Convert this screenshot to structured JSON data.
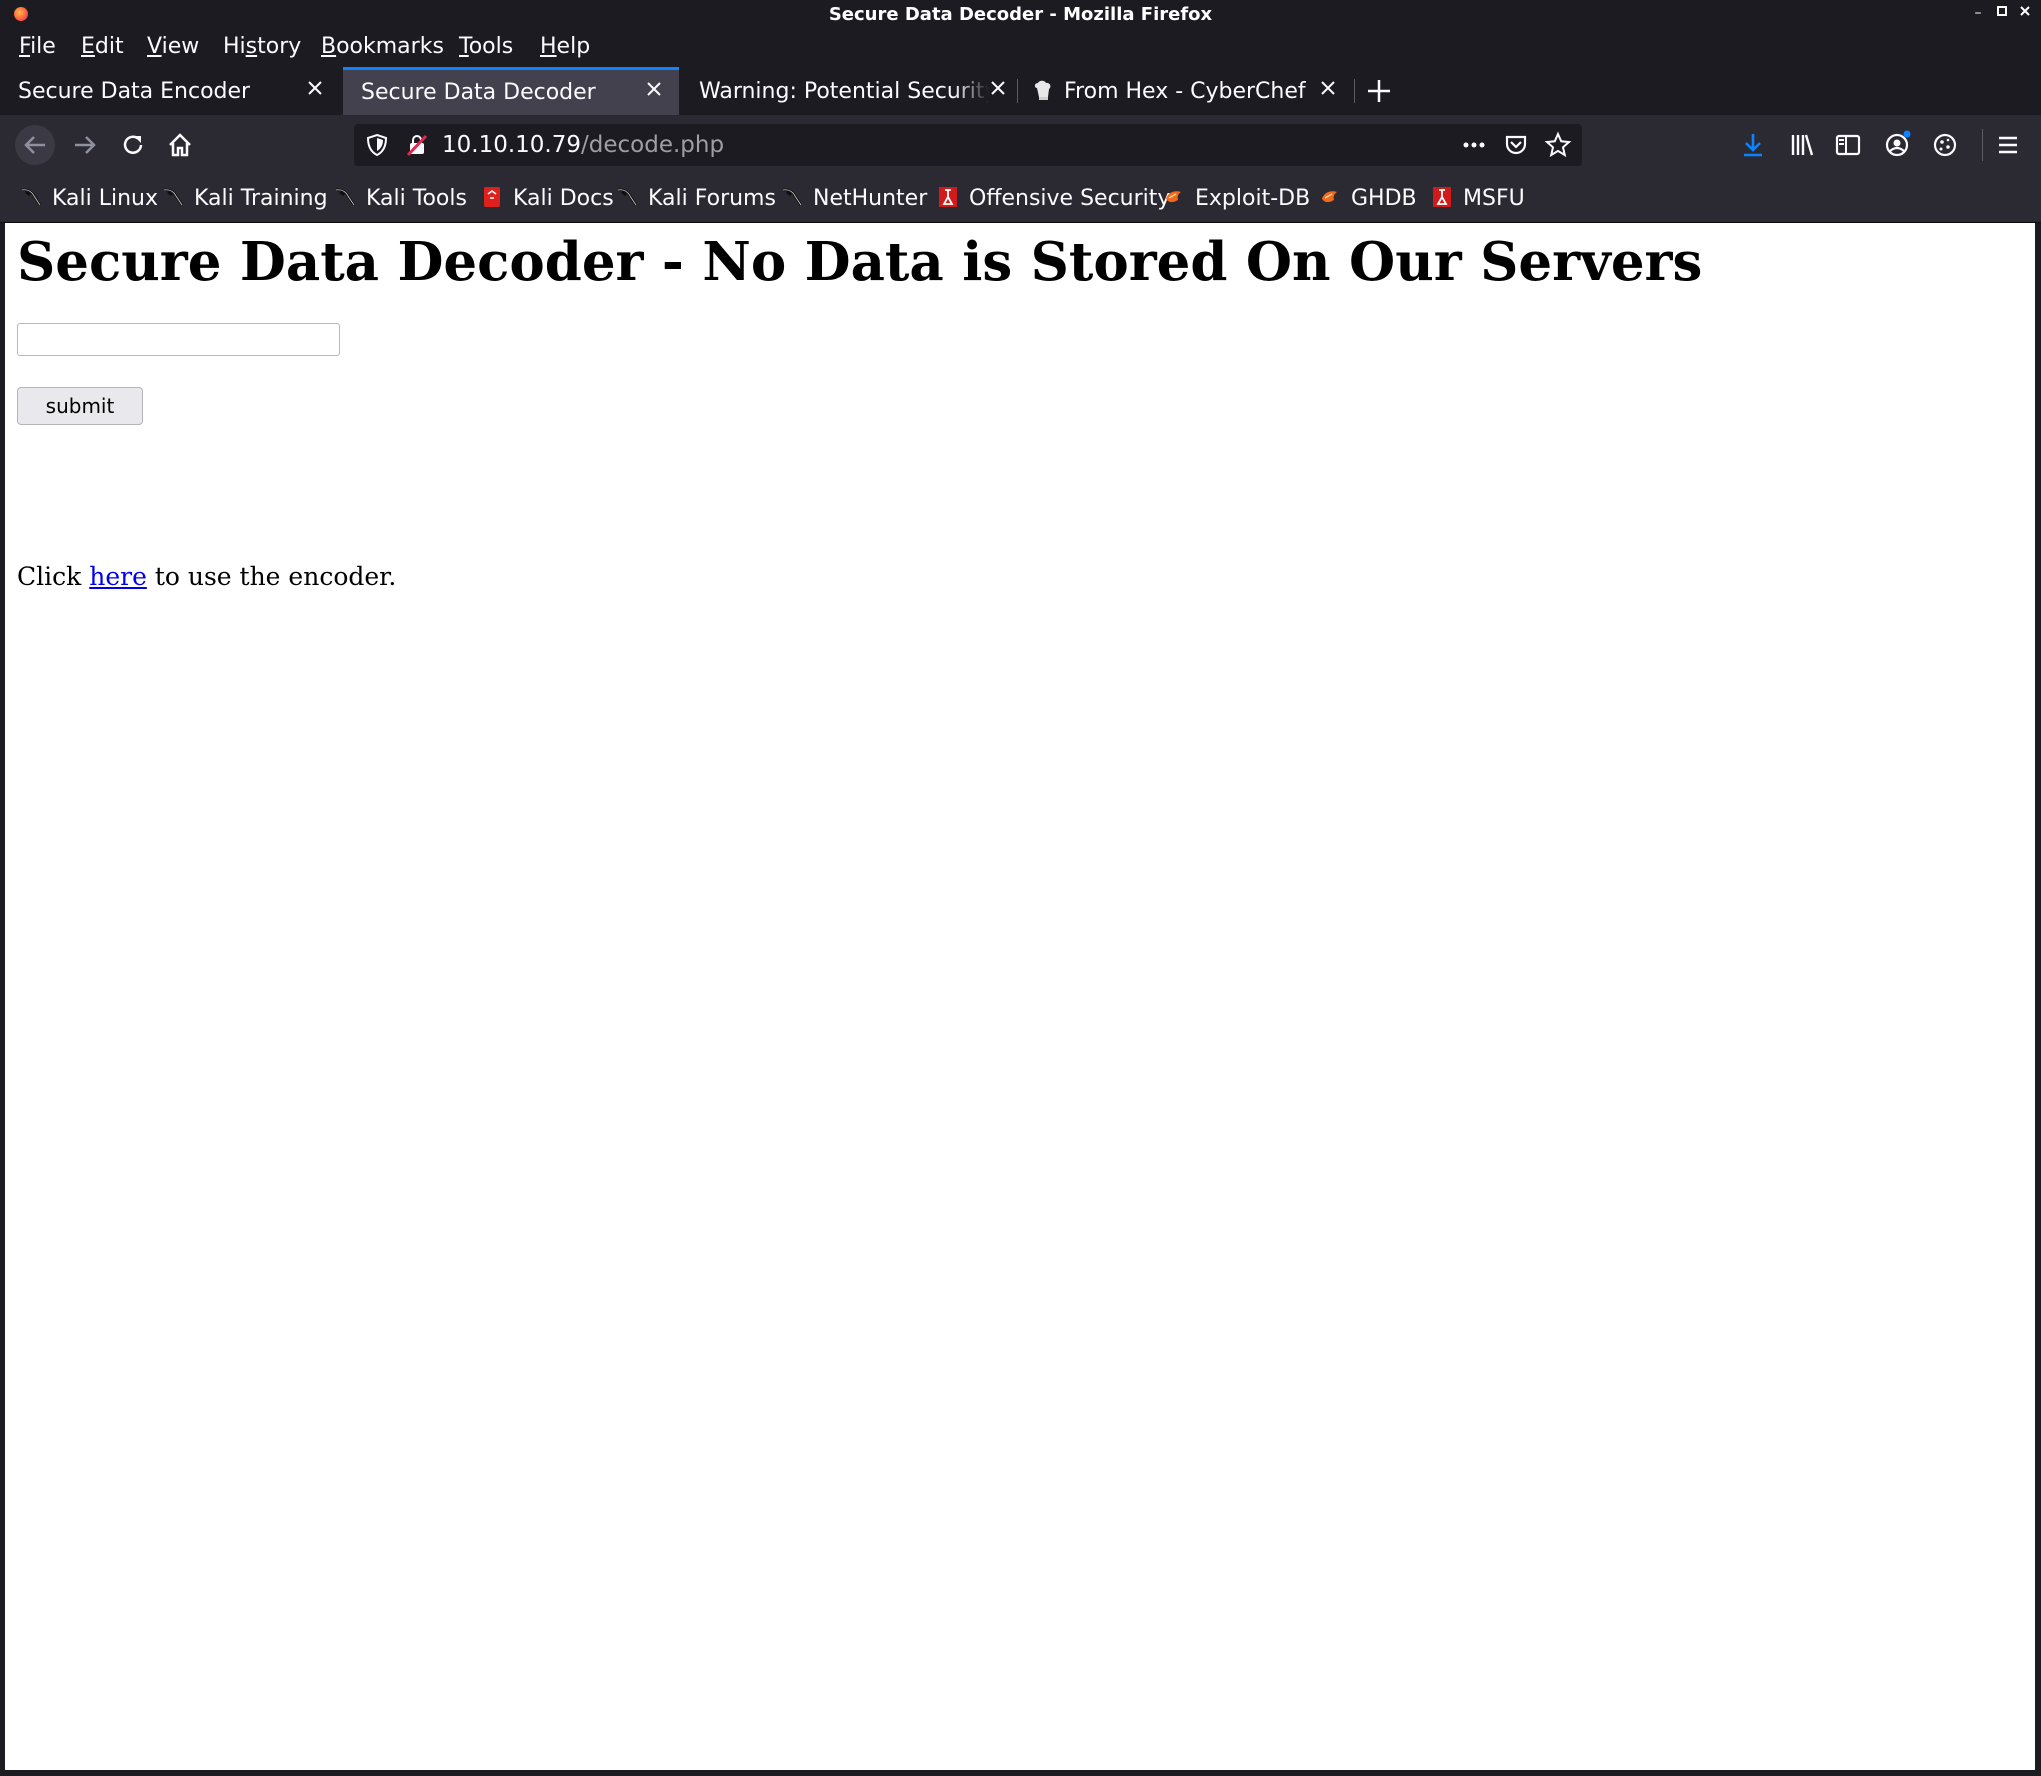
{
  "window": {
    "title": "Secure Data Decoder - Mozilla Firefox",
    "controls": [
      "minimize",
      "maximize",
      "close"
    ]
  },
  "menu": [
    {
      "label": "File",
      "accel": "F",
      "rest": "ile"
    },
    {
      "label": "Edit",
      "accel": "E",
      "rest": "dit"
    },
    {
      "label": "View",
      "accel": "V",
      "rest": "iew"
    },
    {
      "label": "History",
      "pre": "Hi",
      "accel": "s",
      "rest": "tory"
    },
    {
      "label": "Bookmarks",
      "accel": "B",
      "rest": "ookmarks"
    },
    {
      "label": "Tools",
      "accel": "T",
      "rest": "ools"
    },
    {
      "label": "Help",
      "accel": "H",
      "rest": "elp"
    }
  ],
  "tabs": [
    {
      "label": "Secure Data Encoder",
      "active": false
    },
    {
      "label": "Secure Data Decoder",
      "active": true
    },
    {
      "label": "Warning: Potential Security Risk Ahead",
      "active": false
    },
    {
      "label": "From Hex - CyberChef",
      "active": false,
      "icon": "cyberchef-icon"
    }
  ],
  "navbar": {
    "url_host": "10.10.10.79",
    "url_path": "/decode.php"
  },
  "bookmarks": [
    {
      "label": "Kali Linux",
      "icon": "kali-dragon-icon"
    },
    {
      "label": "Kali Training",
      "icon": "kali-dragon-icon"
    },
    {
      "label": "Kali Tools",
      "icon": "kali-dragon-icon"
    },
    {
      "label": "Kali Docs",
      "icon": "kali-docs-icon"
    },
    {
      "label": "Kali Forums",
      "icon": "kali-dragon-icon"
    },
    {
      "label": "NetHunter",
      "icon": "kali-dragon-icon"
    },
    {
      "label": "Offensive Security",
      "icon": "offsec-icon"
    },
    {
      "label": "Exploit-DB",
      "icon": "exploitdb-icon"
    },
    {
      "label": "GHDB",
      "icon": "exploitdb-icon"
    },
    {
      "label": "MSFU",
      "icon": "offsec-icon"
    }
  ],
  "page": {
    "heading": "Secure Data Decoder - No Data is Stored On Our Servers",
    "input_value": "",
    "submit_label": "submit",
    "click_prefix": "Click ",
    "link_text": "here",
    "click_suffix": " to use the encoder."
  },
  "colors": {
    "accent": "#0a84ff",
    "link": "#0000ee",
    "chrome_dark": "#1c1b22",
    "chrome_toolbar": "#2b2a33"
  }
}
